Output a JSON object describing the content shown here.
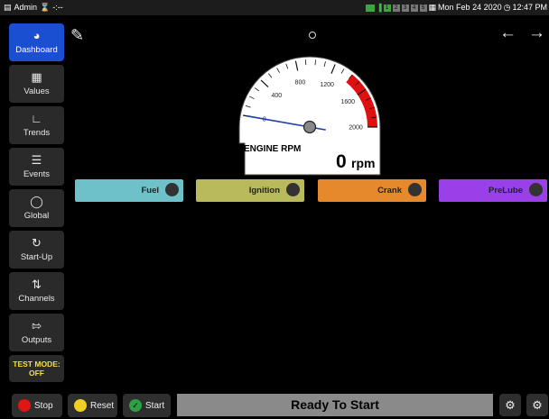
{
  "topbar": {
    "user": "Admin",
    "status_text": "-:--",
    "indicators": [
      "1",
      "2",
      "3",
      "4",
      "5"
    ],
    "datetime": "Mon Feb 24 2020",
    "time": "12:47 PM"
  },
  "sidebar": {
    "items": [
      {
        "label": "Dashboard",
        "icon": "dashboard-icon",
        "active": true
      },
      {
        "label": "Values",
        "icon": "table-icon"
      },
      {
        "label": "Trends",
        "icon": "line-chart-icon"
      },
      {
        "label": "Events",
        "icon": "list-icon"
      },
      {
        "label": "Global",
        "icon": "globe-icon"
      },
      {
        "label": "Start-Up",
        "icon": "circular-arrow-icon"
      },
      {
        "label": "Channels",
        "icon": "channels-icon"
      },
      {
        "label": "Outputs",
        "icon": "output-icon"
      }
    ],
    "test_mode_line1": "TEST MODE:",
    "test_mode_line2": "OFF"
  },
  "gauge": {
    "title": "ENGINE RPM",
    "value": "0",
    "unit": "rpm",
    "reading": 0,
    "ticks": [
      "0",
      "400",
      "800",
      "1200",
      "1600",
      "2000"
    ],
    "min": 0,
    "max": 2000,
    "redline_start": 1400,
    "redline_color": "#e01010"
  },
  "indicators": [
    {
      "label": "Fuel",
      "color": "#6ec1c8"
    },
    {
      "label": "Ignition",
      "color": "#b8ba5c"
    },
    {
      "label": "Crank",
      "color": "#e6882c"
    },
    {
      "label": "PreLube",
      "color": "#9a40e8"
    }
  ],
  "bottom": {
    "stop_label": "Stop",
    "reset_label": "Reset",
    "start_label": "Start",
    "status": "Ready To Start"
  },
  "colors": {
    "nav_active": "#1b4fd1",
    "stop": "#e01515",
    "reset": "#f0d020",
    "start": "#2ea043"
  }
}
